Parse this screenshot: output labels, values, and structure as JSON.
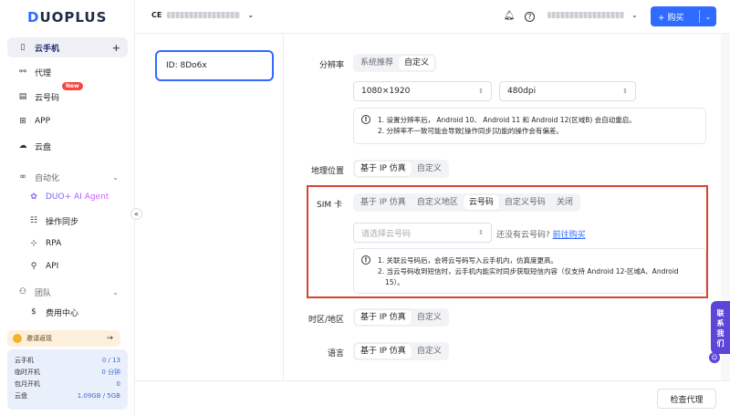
{
  "brand": {
    "logo_text": "DUOPLUS"
  },
  "sidebar": {
    "items": [
      {
        "label": "云手机",
        "icon": "phone-icon",
        "extra": "+"
      },
      {
        "label": "代理",
        "icon": "network-icon"
      },
      {
        "label": "云号码",
        "icon": "sim-icon",
        "badge": "New"
      },
      {
        "label": "APP",
        "icon": "grid-icon"
      },
      {
        "label": "云盘",
        "icon": "cloud-icon"
      },
      {
        "label": "自动化",
        "icon": "infinity-icon"
      },
      {
        "label": "DUO+ AI Agent",
        "icon": "ai-icon"
      },
      {
        "label": "操作同步",
        "icon": "sync-icon"
      },
      {
        "label": "RPA",
        "icon": "rpa-icon"
      },
      {
        "label": "API",
        "icon": "api-icon"
      },
      {
        "label": "团队",
        "icon": "team-icon"
      },
      {
        "label": "费用中心",
        "icon": "dollar-icon"
      }
    ],
    "invite": {
      "label": "邀请返现",
      "arrow": "→"
    },
    "quota": [
      {
        "k": "云手机",
        "v": "0 / 13"
      },
      {
        "k": "临时开机",
        "v": "0 分钟"
      },
      {
        "k": "包月开机",
        "v": "0"
      },
      {
        "k": "云盘",
        "v": "1.09GB / 5GB"
      }
    ],
    "collapse": "«"
  },
  "header": {
    "account_prefix": "CE",
    "buy_label": "+ 购买"
  },
  "device": {
    "id_label": "ID: 8Do6x"
  },
  "form": {
    "resolution": {
      "label": "分辨率",
      "options": [
        "系统推荐",
        "自定义"
      ],
      "active": 1,
      "size_value": "1080×1920",
      "dpi_value": "480dpi",
      "notes": [
        "1. 设置分辨率后， Android 10、 Android 11 和 Android 12(区域B) 会自动重启。",
        "2. 分辨率不一致可能会导致[操作同步]功能的操作会有偏差。"
      ]
    },
    "geo": {
      "label": "地理位置",
      "options": [
        "基于 IP 仿真",
        "自定义"
      ],
      "active": 0
    },
    "sim": {
      "label": "SIM 卡",
      "options": [
        "基于 IP 仿真",
        "自定义地区",
        "云号码",
        "自定义号码",
        "关闭"
      ],
      "active": 2,
      "select_placeholder": "请选择云号码",
      "no_number_text": "还没有云号码?",
      "buy_link": "前往购买",
      "notes": [
        "1. 关联云号码后，会将云号码写入云手机内，仿真度更高。",
        "2. 当云号码收到短信时，云手机内能实时同步获取短信内容（仅支持 Android 12-区域A、Android",
        "15）。"
      ]
    },
    "timezone": {
      "label": "时区/地区",
      "options": [
        "基于 IP 仿真",
        "自定义"
      ],
      "active": 0
    },
    "language": {
      "label": "语言",
      "options": [
        "基于 IP 仿真",
        "自定义"
      ],
      "active": 0
    }
  },
  "footer": {
    "check_proxy": "检查代理"
  },
  "contact": {
    "label": "联系我们"
  },
  "colors": {
    "primary": "#2f6bff",
    "highlight": "#d9432f",
    "contact": "#5b46d9"
  }
}
